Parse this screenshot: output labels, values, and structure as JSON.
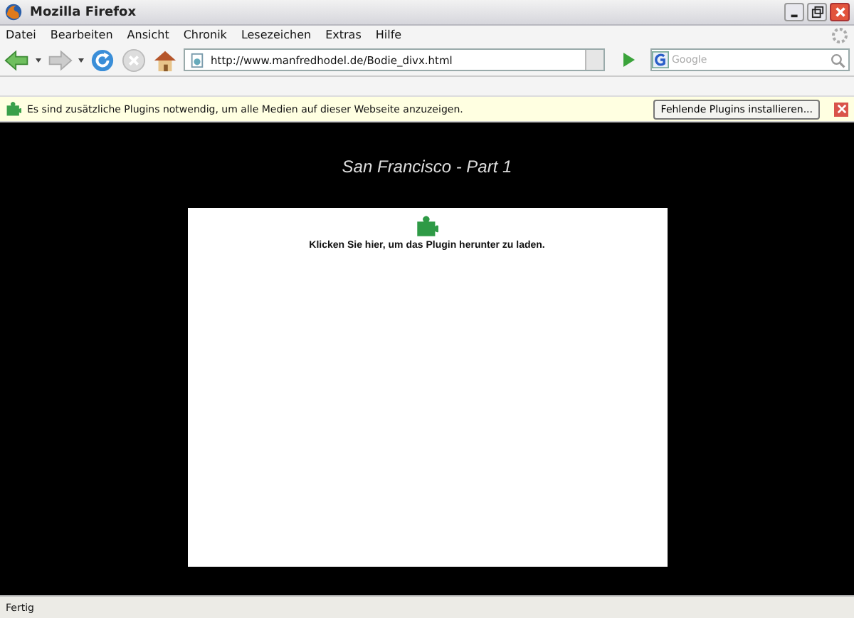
{
  "window": {
    "title": "Mozilla Firefox"
  },
  "menu": [
    "Datei",
    "Bearbeiten",
    "Ansicht",
    "Chronik",
    "Lesezeichen",
    "Extras",
    "Hilfe"
  ],
  "address_bar": {
    "value": "http://www.manfredhodel.de/Bodie_divx.html"
  },
  "search": {
    "placeholder": "Google"
  },
  "notification": {
    "message": "Es sind zusätzliche Plugins notwendig, um alle Medien auf dieser Webseite anzuzeigen.",
    "button": "Fehlende Plugins installieren..."
  },
  "page": {
    "heading": "San Francisco - Part 1",
    "plugin_message": "Klicken Sie hier, um das Plugin herunter zu laden."
  },
  "status_bar": {
    "text": "Fertig"
  }
}
